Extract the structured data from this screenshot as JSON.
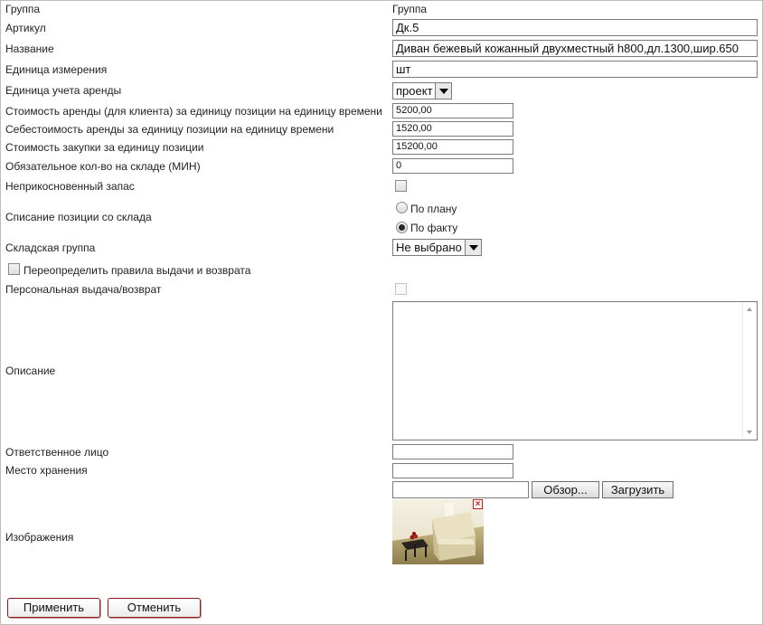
{
  "header": {
    "left": "Группа",
    "right": "Группа"
  },
  "fields": {
    "article": {
      "label": "Артикул",
      "value": "Дк.5"
    },
    "name": {
      "label": "Название",
      "value": "Диван бежевый кожанный двухместный h800,дл.1300,шир.650"
    },
    "unit": {
      "label": "Единица измерения",
      "value": "шт"
    },
    "rent_unit": {
      "label": "Единица учета аренды",
      "value": "проект"
    },
    "rent_cost_client": {
      "label": "Стоимость аренды (для клиента) за единицу позиции на единицу времени",
      "value": "5200,00"
    },
    "rent_self_cost": {
      "label": "Себестоимость аренды за единицу позиции на единицу времени",
      "value": "1520,00"
    },
    "purchase_cost": {
      "label": "Стоимость закупки за единицу позиции",
      "value": "15200,00"
    },
    "min_qty": {
      "label": "Обязательное кол-во на складе (МИН)",
      "value": "0"
    },
    "reserve": {
      "label": "Неприкосновенный запас"
    },
    "writeoff": {
      "label": "Списание позиции со склада",
      "option_plan": "По плану",
      "option_fact": "По факту",
      "selected": "По факту"
    },
    "stock_group": {
      "label": "Складская группа",
      "value": "Не выбрано"
    },
    "override_rules": {
      "label": "Переопределить правила выдачи и возврата"
    },
    "personal_issue": {
      "label": "Персональная выдача/возврат"
    },
    "description": {
      "label": "Описание",
      "value": ""
    },
    "responsible": {
      "label": "Ответственное лицо",
      "value": ""
    },
    "storage_place": {
      "label": "Место хранения",
      "value": ""
    },
    "images": {
      "label": "Изображения",
      "browse_label": "Обзор...",
      "upload_label": "Загрузить"
    }
  },
  "actions": {
    "apply": "Применить",
    "cancel": "Отменить"
  },
  "colors": {
    "accent_border": "#8b1c1c",
    "remove_icon": "#c02020"
  }
}
